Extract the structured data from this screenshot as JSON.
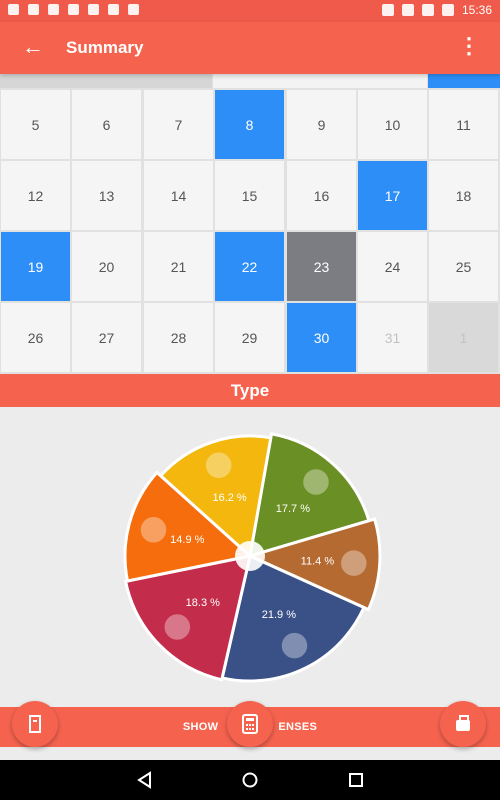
{
  "status_bar": {
    "time": "15:36"
  },
  "app_bar": {
    "title": "Summary",
    "back_icon": "back-arrow-icon",
    "menu_icon": "more-vert-icon"
  },
  "calendar": {
    "rows": [
      [
        {
          "day": "5",
          "state": "normal"
        },
        {
          "day": "6",
          "state": "normal"
        },
        {
          "day": "7",
          "state": "normal"
        },
        {
          "day": "8",
          "state": "selected"
        },
        {
          "day": "9",
          "state": "normal"
        },
        {
          "day": "10",
          "state": "normal"
        },
        {
          "day": "11",
          "state": "normal"
        }
      ],
      [
        {
          "day": "12",
          "state": "normal"
        },
        {
          "day": "13",
          "state": "normal"
        },
        {
          "day": "14",
          "state": "normal"
        },
        {
          "day": "15",
          "state": "normal"
        },
        {
          "day": "16",
          "state": "normal"
        },
        {
          "day": "17",
          "state": "selected"
        },
        {
          "day": "18",
          "state": "normal"
        }
      ],
      [
        {
          "day": "19",
          "state": "selected"
        },
        {
          "day": "20",
          "state": "normal"
        },
        {
          "day": "21",
          "state": "normal"
        },
        {
          "day": "22",
          "state": "selected"
        },
        {
          "day": "23",
          "state": "today"
        },
        {
          "day": "24",
          "state": "normal"
        },
        {
          "day": "25",
          "state": "normal"
        }
      ],
      [
        {
          "day": "26",
          "state": "normal"
        },
        {
          "day": "27",
          "state": "normal"
        },
        {
          "day": "28",
          "state": "normal"
        },
        {
          "day": "29",
          "state": "normal"
        },
        {
          "day": "30",
          "state": "selected"
        },
        {
          "day": "31",
          "state": "faded"
        },
        {
          "day": "1",
          "state": "next"
        }
      ]
    ]
  },
  "type_header": "Type",
  "pie": {
    "slices": [
      {
        "label": "17.7 %",
        "value": 17.7,
        "color": "#6a8f24",
        "icon": "gift-icon"
      },
      {
        "label": "11.4 %",
        "value": 11.4,
        "color": "#b56a32",
        "icon": "cloud-icon"
      },
      {
        "label": "21.9 %",
        "value": 21.9,
        "color": "#3a5188",
        "icon": "money-bag-icon"
      },
      {
        "label": "18.3 %",
        "value": 18.3,
        "color": "#c42c4c",
        "icon": "bed-icon"
      },
      {
        "label": "14.9 %",
        "value": 14.9,
        "color": "#f56d0c",
        "icon": "cart-icon"
      },
      {
        "label": "16.2 %",
        "value": 16.2,
        "color": "#f3b70e",
        "icon": "car-icon"
      }
    ]
  },
  "bottom": {
    "label_left": "SHOW",
    "label_right": "ENSES"
  }
}
